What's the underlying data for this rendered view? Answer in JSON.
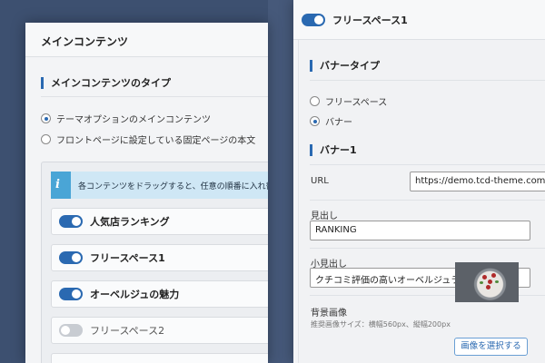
{
  "left_panel": {
    "header_title": "メインコンテンツ",
    "section_title": "メインコンテンツのタイプ",
    "radio_options": [
      {
        "label": "テーマオプションのメインコンテンツ",
        "checked": true
      },
      {
        "label": "フロントページに設定している固定ページの本文",
        "checked": false
      }
    ],
    "info_icon": "info-icon",
    "info_text": "各コンテンツをドラッグすると、任意の順番に入れ替えられ",
    "items": [
      {
        "label": "人気店ランキング",
        "enabled": true
      },
      {
        "label": "フリースペース1",
        "enabled": true
      },
      {
        "label": "オーベルジュの魅力",
        "enabled": true
      },
      {
        "label": "フリースペース2",
        "enabled": false
      }
    ]
  },
  "right_panel": {
    "header_title": "フリースペース1",
    "header_toggle_on": true,
    "banner_type_title": "バナータイプ",
    "banner_type_options": [
      {
        "label": "フリースペース",
        "checked": false
      },
      {
        "label": "バナー",
        "checked": true
      }
    ],
    "banner_section_title": "バナー1",
    "url_label": "URL",
    "url_value": "https://demo.tcd-theme.com/tcd",
    "heading_label": "見出し",
    "heading_value": "RANKING",
    "subheading_label": "小見出し",
    "subheading_value": "クチコミ評価の高いオーベルジュランキング",
    "bg_image_label": "背景画像",
    "bg_image_recommend": "推奨画像サイズ：横幅560px、縦幅200px",
    "select_image_button": "画像を選択する"
  },
  "colors": {
    "accent": "#2a69b1",
    "background": "#3d5070",
    "info_bar": "#cfe7f5",
    "info_icon_bg": "#4aa5d6"
  }
}
